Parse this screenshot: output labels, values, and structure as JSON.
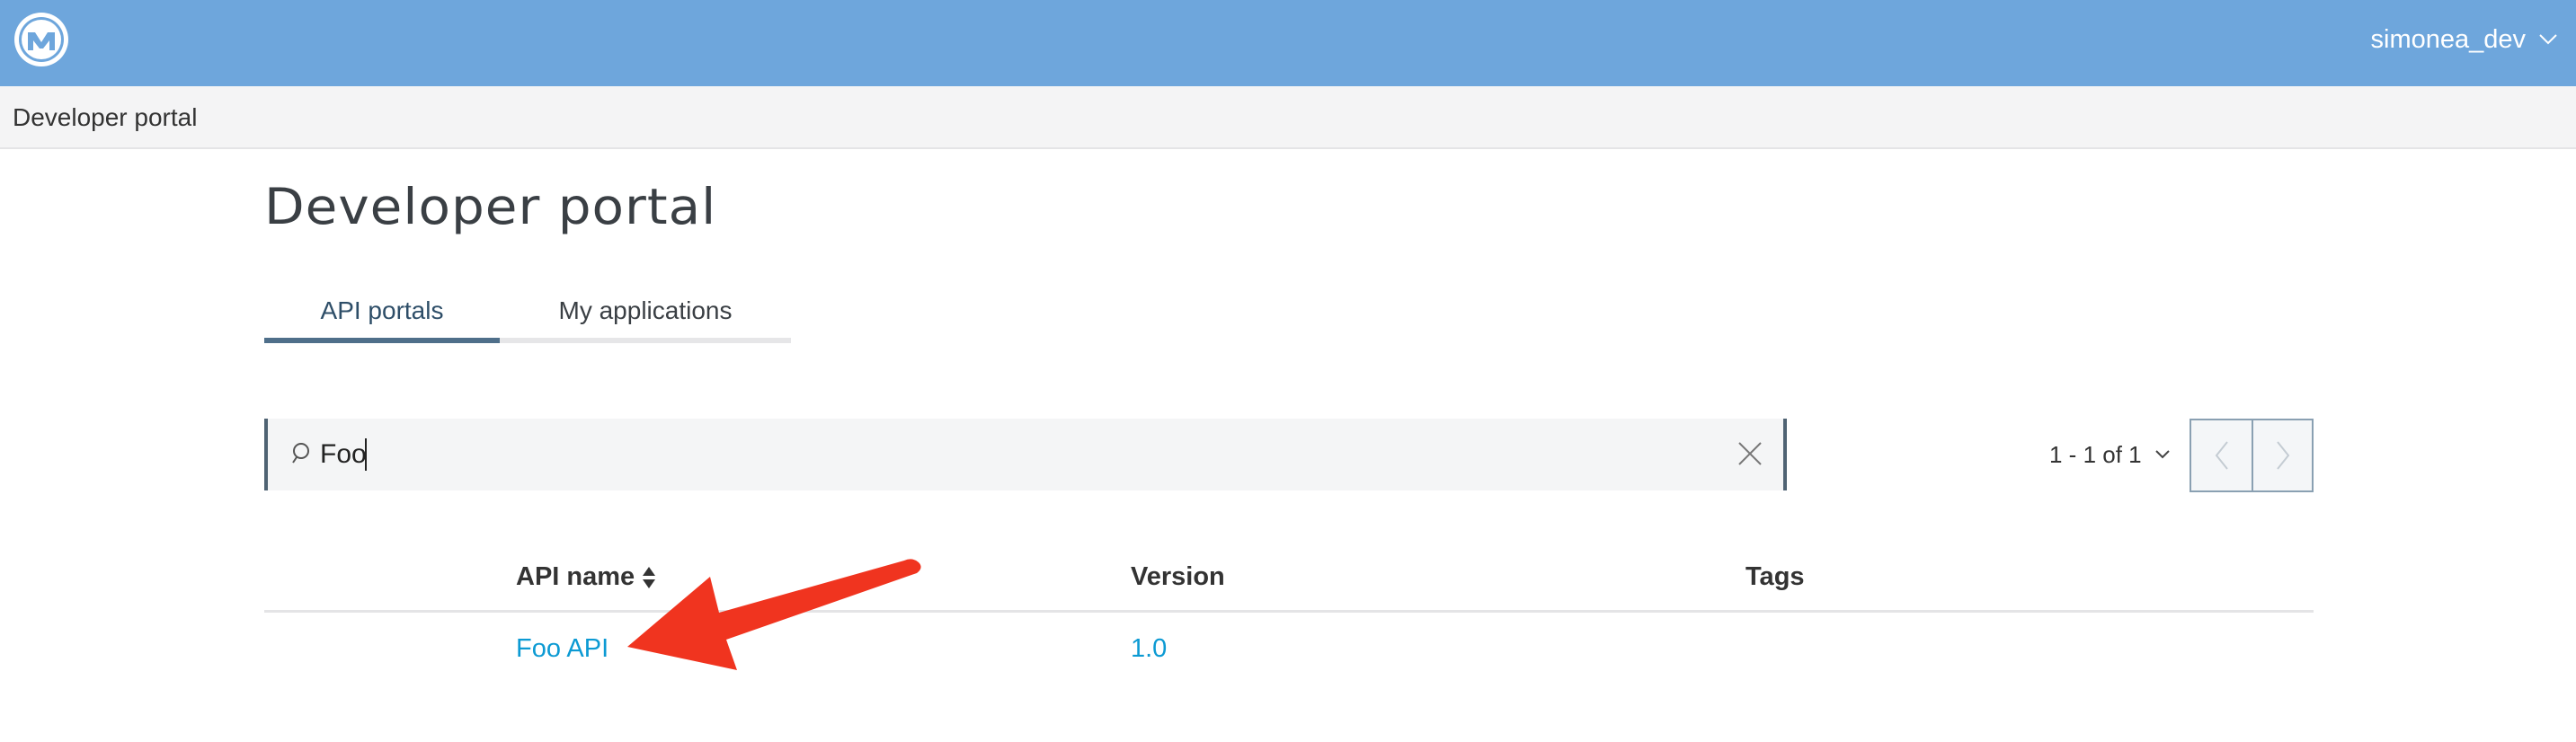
{
  "topbar": {
    "brand_color": "#6ea6dc",
    "logo_icon": "mulesoft-logo",
    "username": "simonea_dev",
    "user_menu_icon": "chevron-down-icon"
  },
  "subbar": {
    "label": "Developer portal"
  },
  "page": {
    "title": "Developer portal"
  },
  "tabs": [
    {
      "label": "API portals",
      "active": true
    },
    {
      "label": "My applications",
      "active": false
    }
  ],
  "search": {
    "value": "Foo",
    "icon": "search-icon",
    "clear_icon": "close-icon"
  },
  "pagination": {
    "range_label": "1 - 1 of 1",
    "dropdown_icon": "chevron-down-icon",
    "prev_icon": "chevron-left-icon",
    "next_icon": "chevron-right-icon"
  },
  "table": {
    "columns": [
      "API name",
      "Version",
      "Tags"
    ],
    "sort_icon": "sort-icon",
    "rows": [
      {
        "name": "Foo API",
        "version": "1.0",
        "tags": ""
      }
    ]
  },
  "annotation": {
    "arrow_color": "#f0341f"
  },
  "colors": {
    "link": "#0c9ad3",
    "tab_active_underline": "#4f6f8a"
  }
}
